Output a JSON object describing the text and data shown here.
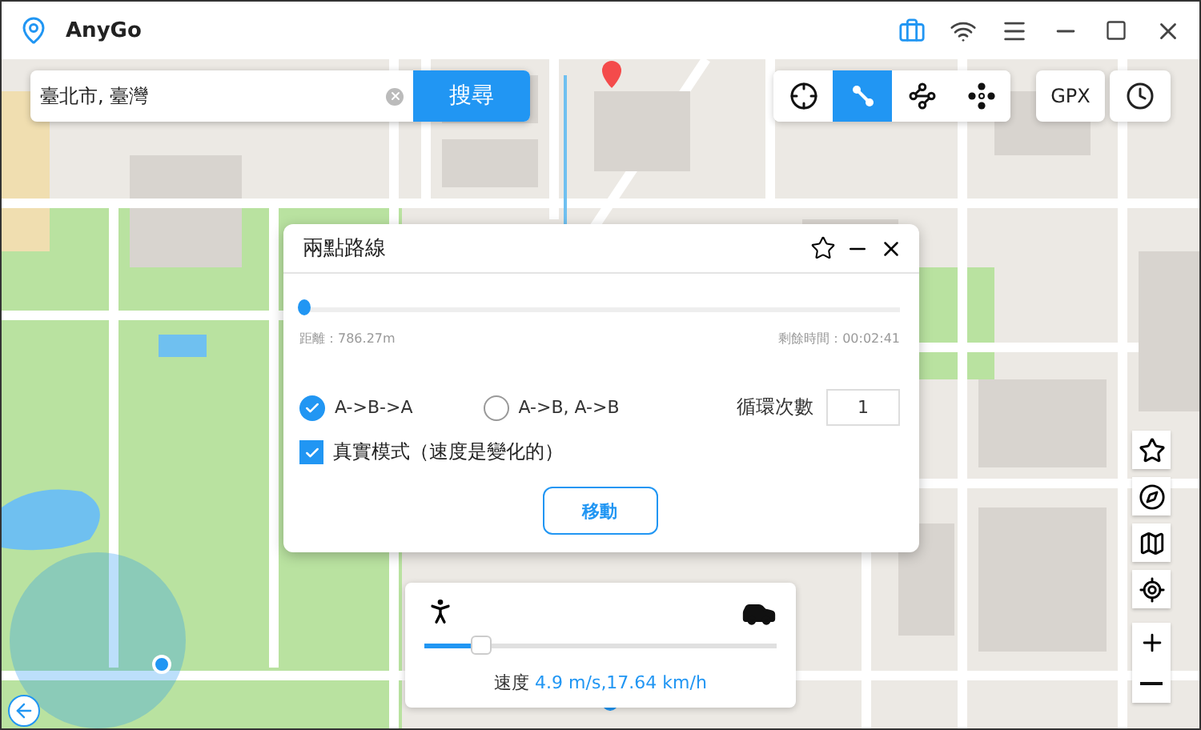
{
  "window": {
    "title": "AnyGo"
  },
  "search": {
    "value": "臺北市, 臺灣",
    "button": "搜尋"
  },
  "modes": [
    {
      "kind": "teleport",
      "selected": false
    },
    {
      "kind": "two-spot",
      "selected": true
    },
    {
      "kind": "multi-spot",
      "selected": false
    },
    {
      "kind": "joystick",
      "selected": false
    }
  ],
  "gpx_button": "GPX",
  "dialog": {
    "title": "兩點路線",
    "progress": {
      "level": 0
    },
    "distance": "距離：786.27m",
    "remaining": "剩餘時間：00:02:41",
    "route_options": [
      {
        "label": "A->B->A",
        "selected": true
      },
      {
        "label": "A->B, A->B",
        "selected": false
      }
    ],
    "loop_label": "循環次數",
    "loop_count": "1",
    "realistic": {
      "label": "真實模式（速度是變化的）",
      "checked": true
    },
    "move_button": "移動"
  },
  "speed": {
    "level": 0.16,
    "label": "速度",
    "value": "4.9 m/s,17.64 km/h"
  }
}
